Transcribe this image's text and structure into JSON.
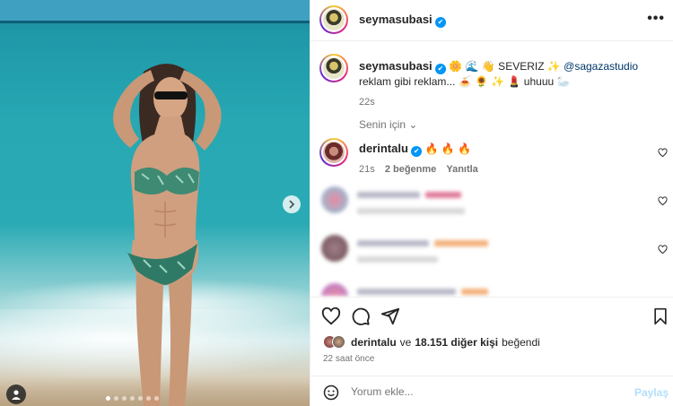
{
  "photo": {
    "slide_count": 7,
    "active_slide": 1
  },
  "header": {
    "username": "seymasubasi",
    "verified_mark": "✔",
    "more_icon": "•••"
  },
  "caption": {
    "username": "seymasubasi",
    "text_before_mention": "🌼 🌊 👋 SEVERIZ ✨",
    "mention": "@sagazastudio",
    "text_after_mention": "reklam gibi reklam... 🍝 🌻 ✨ 💄 uhuuu 🦢",
    "time": "22s"
  },
  "for_you": {
    "label": "Senin için",
    "chevron": "⌄"
  },
  "comments": [
    {
      "username": "derintalu",
      "text": "🔥 🔥 🔥",
      "time": "21s",
      "likes": "2 beğenme",
      "reply": "Yanıtla"
    }
  ],
  "likes": {
    "first_liker": "derintalu",
    "connector": "ve",
    "others": "18.151 diğer kişi",
    "suffix": "beğendi"
  },
  "post_time": "22 saat önce",
  "comment_bar": {
    "placeholder": "Yorum ekle...",
    "post_label": "Paylaş"
  },
  "colors": {
    "verified": "#0095f6",
    "link": "#00376b",
    "post_disabled": "#b2dffc"
  }
}
